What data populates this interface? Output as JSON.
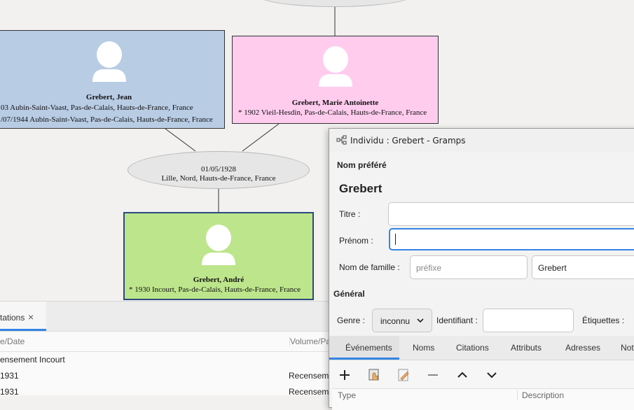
{
  "tree": {
    "family_top": {
      "date": "",
      "place": ""
    },
    "father": {
      "name": "Grebert, Jean",
      "birth": "03  Aubin-Saint-Vaast, Pas-de-Calais, Hauts-de-France, France",
      "death": "/07/1944  Aubin-Saint-Vaast, Pas-de-Calais, Hauts-de-France, France",
      "color": "#b8cce4"
    },
    "mother": {
      "name": "Grebert, Marie Antoinette",
      "birth": "* 1902  Vieil-Hesdin, Pas-de-Calais, Hauts-de-France, France",
      "color": "#ffccee"
    },
    "family": {
      "date": "01/05/1928",
      "place": "Lille, Nord, Hauts-de-France, France"
    },
    "child": {
      "name": "Grebert, André",
      "birth": "* 1930  Incourt, Pas-de-Calais, Hauts-de-France, France",
      "color": "#bde58b"
    }
  },
  "citations_panel": {
    "tab_label": "tations",
    "close_icon": "×",
    "columns": [
      "e/Date",
      "Volume/Pa"
    ],
    "rows": [
      {
        "date": "ensement Incourt",
        "volume": ""
      },
      {
        "date": "1931",
        "volume": "Recenseme"
      },
      {
        "date": "1931",
        "volume": "Recenseme"
      }
    ]
  },
  "dialog": {
    "title": "Individu : Grebert - Gramps",
    "section_preferred": "Nom préféré",
    "display_name": "Grebert",
    "title_label": "Titre :",
    "title_value": "",
    "firstname_label": "Prénom :",
    "firstname_value": "",
    "surname_label": "Nom de famille :",
    "prefix_placeholder": "préfixe",
    "surname_value": "Grebert",
    "section_general": "Général",
    "gender_label": "Genre :",
    "gender_value": "inconnu",
    "id_label": "Identifiant :",
    "id_value": "",
    "tags_label": "Étiquettes :",
    "tabs": [
      "Événements",
      "Noms",
      "Citations",
      "Attributs",
      "Adresses",
      "Not"
    ],
    "toolbar_icons": [
      "add-icon",
      "share-icon",
      "edit-icon",
      "remove-icon",
      "move-up-icon",
      "move-down-icon"
    ],
    "events_columns": [
      "Type",
      "Description"
    ]
  },
  "colors": {
    "accent": "#3584e4"
  }
}
